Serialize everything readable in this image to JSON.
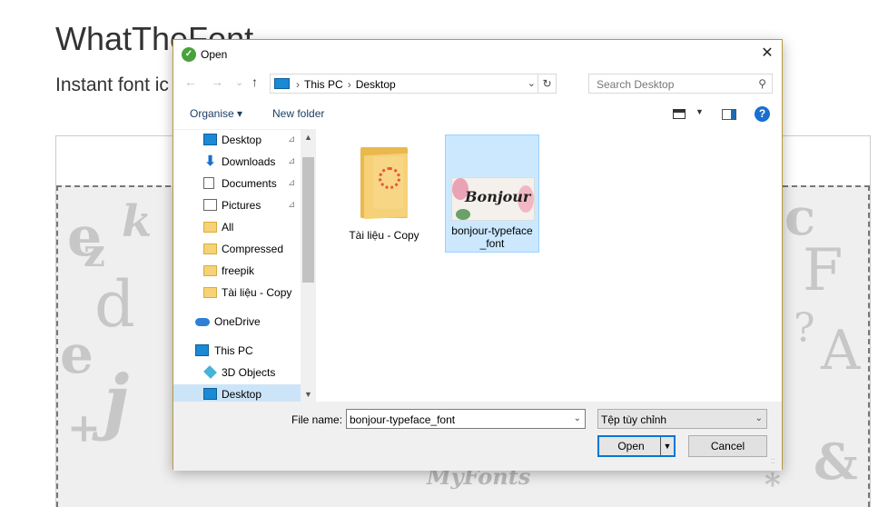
{
  "page": {
    "title": "WhatTheFont",
    "subtitle": "Instant font ic",
    "watermark": "MyFonts",
    "bg_letters": [
      "e",
      "k",
      "z",
      "d",
      "e",
      "j",
      "+",
      "c",
      "F",
      "?",
      "A",
      "&",
      "*"
    ]
  },
  "dialog": {
    "title": "Open",
    "close_glyph": "✕",
    "nav": {
      "back": "←",
      "forward": "→",
      "recent": "⌄",
      "up": "↑",
      "address": [
        "This PC",
        "Desktop"
      ],
      "address_sep": "›",
      "dropdown": "⌄",
      "refresh": "↻",
      "search_placeholder": "Search Desktop",
      "search_glyph": "⚲"
    },
    "toolbar": {
      "organise": "Organise ▾",
      "new_folder": "New folder",
      "view_dd": "▼",
      "help": "?"
    },
    "nav_items": [
      {
        "label": "Desktop",
        "icon": "desktop-icon",
        "pinned": true,
        "level": 1
      },
      {
        "label": "Downloads",
        "icon": "downloads-icon",
        "pinned": true,
        "level": 1
      },
      {
        "label": "Documents",
        "icon": "documents-icon",
        "pinned": true,
        "level": 1
      },
      {
        "label": "Pictures",
        "icon": "pictures-icon",
        "pinned": true,
        "level": 1
      },
      {
        "label": "All",
        "icon": "folder-icon",
        "pinned": false,
        "level": 1
      },
      {
        "label": "Compressed",
        "icon": "folder-icon",
        "pinned": false,
        "level": 1
      },
      {
        "label": "freepik",
        "icon": "folder-icon",
        "pinned": false,
        "level": 1
      },
      {
        "label": "Tài liệu - Copy",
        "icon": "folder-icon",
        "pinned": false,
        "level": 1
      },
      {
        "label": "OneDrive",
        "icon": "onedrive-icon",
        "pinned": false,
        "level": 0
      },
      {
        "label": "This PC",
        "icon": "this-pc-icon",
        "pinned": false,
        "level": 0
      },
      {
        "label": "3D Objects",
        "icon": "3d-objects-icon",
        "pinned": false,
        "level": 1
      },
      {
        "label": "Desktop",
        "icon": "desktop-icon",
        "pinned": false,
        "level": 1,
        "selected": true
      }
    ],
    "pin_glyph": "📌",
    "scroll_up": "▲",
    "scroll_down": "▼",
    "files": [
      {
        "name": "Tài liệu - Copy",
        "type": "folder",
        "selected": false
      },
      {
        "name": "bonjour-typeface_font",
        "type": "image",
        "selected": true,
        "thumbnail_text": "Bonjour"
      }
    ],
    "bottom": {
      "file_name_label": "File name:",
      "file_name_value": "bonjour-typeface_font",
      "file_type_value": "Tệp tùy chỉnh",
      "open_label": "Open",
      "open_split": "▼",
      "cancel_label": "Cancel",
      "combo_arrow": "⌄"
    }
  },
  "colors": {
    "accent": "#0078d7",
    "selection": "#cce8ff",
    "dialog_border": "#b89a3d"
  }
}
